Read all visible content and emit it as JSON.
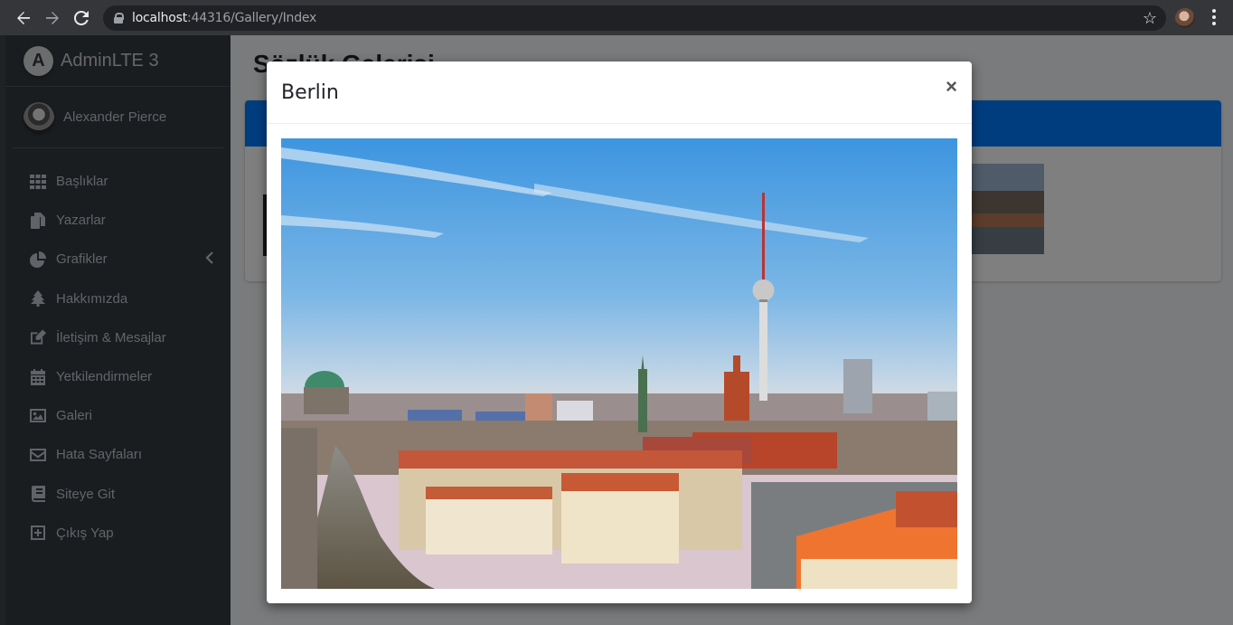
{
  "browser": {
    "url_host": "localhost",
    "url_rest": ":44316/Gallery/Index"
  },
  "brand": {
    "title": "AdminLTE 3",
    "logo_letter": "A"
  },
  "user": {
    "name": "Alexander Pierce"
  },
  "menu": [
    {
      "label": "Başlıklar",
      "icon": "th-icon"
    },
    {
      "label": "Yazarlar",
      "icon": "copy-icon"
    },
    {
      "label": "Grafikler",
      "icon": "chart-pie-icon"
    },
    {
      "label": "Hakkımızda",
      "icon": "tree-icon"
    },
    {
      "label": "İletişim & Mesajlar",
      "icon": "edit-icon"
    },
    {
      "label": "Yetkilendirmeler",
      "icon": "calendar-icon"
    },
    {
      "label": "Galeri",
      "icon": "image-icon"
    },
    {
      "label": "Hata Sayfaları",
      "icon": "envelope-icon"
    },
    {
      "label": "Siteye Git",
      "icon": "book-icon"
    },
    {
      "label": "Çıkış Yap",
      "icon": "plus-square-icon"
    }
  ],
  "page": {
    "title": "Sözlük Galerisi"
  },
  "modal": {
    "title": "Berlin",
    "close": "×"
  },
  "colors": {
    "sidebar": "#343a40",
    "primary": "#007bff",
    "page_bg": "#f4f6f9"
  }
}
